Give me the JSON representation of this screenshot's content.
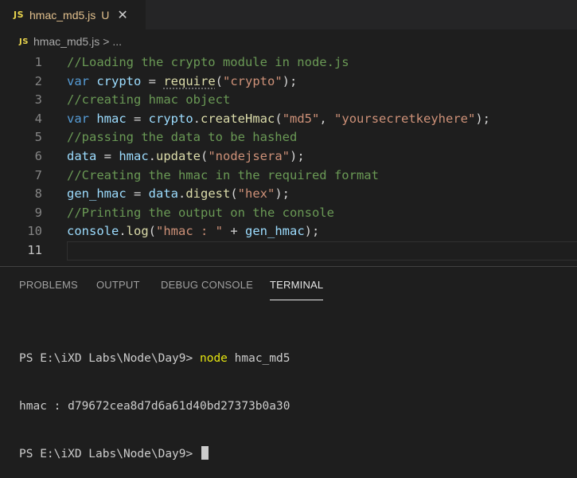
{
  "tab": {
    "badge": "JS",
    "title": "hmac_md5.js",
    "status": "U",
    "close_glyph": "✕"
  },
  "breadcrumb": {
    "badge": "JS",
    "file": "hmac_md5.js",
    "separator": ">",
    "more": "..."
  },
  "editor": {
    "lines": [
      {
        "num": "1",
        "tokens": [
          [
            "comment",
            "//Loading the crypto module in node.js"
          ]
        ]
      },
      {
        "num": "2",
        "tokens": [
          [
            "kw",
            "var"
          ],
          [
            "op",
            " "
          ],
          [
            "var",
            "crypto"
          ],
          [
            "op",
            " = "
          ],
          [
            "fn",
            "require"
          ],
          [
            "op",
            "("
          ],
          [
            "str",
            "\"crypto\""
          ],
          [
            "op",
            ");"
          ]
        ]
      },
      {
        "num": "3",
        "tokens": [
          [
            "comment",
            "//creating hmac object"
          ]
        ]
      },
      {
        "num": "4",
        "tokens": [
          [
            "kw",
            "var"
          ],
          [
            "op",
            " "
          ],
          [
            "var",
            "hmac"
          ],
          [
            "op",
            " = "
          ],
          [
            "var",
            "crypto"
          ],
          [
            "op",
            "."
          ],
          [
            "fn",
            "createHmac"
          ],
          [
            "op",
            "("
          ],
          [
            "str",
            "\"md5\""
          ],
          [
            "op",
            ", "
          ],
          [
            "str",
            "\"yoursecretkeyhere\""
          ],
          [
            "op",
            ");"
          ]
        ]
      },
      {
        "num": "5",
        "tokens": [
          [
            "comment",
            "//passing the data to be hashed"
          ]
        ]
      },
      {
        "num": "6",
        "tokens": [
          [
            "var",
            "data"
          ],
          [
            "op",
            " = "
          ],
          [
            "var",
            "hmac"
          ],
          [
            "op",
            "."
          ],
          [
            "fn",
            "update"
          ],
          [
            "op",
            "("
          ],
          [
            "str",
            "\"nodejsera\""
          ],
          [
            "op",
            ");"
          ]
        ]
      },
      {
        "num": "7",
        "tokens": [
          [
            "comment",
            "//Creating the hmac in the required format"
          ]
        ]
      },
      {
        "num": "8",
        "tokens": [
          [
            "var",
            "gen_hmac"
          ],
          [
            "op",
            " = "
          ],
          [
            "var",
            "data"
          ],
          [
            "op",
            "."
          ],
          [
            "fn",
            "digest"
          ],
          [
            "op",
            "("
          ],
          [
            "str",
            "\"hex\""
          ],
          [
            "op",
            ");"
          ]
        ]
      },
      {
        "num": "9",
        "tokens": [
          [
            "comment",
            "//Printing the output on the console"
          ]
        ]
      },
      {
        "num": "10",
        "tokens": [
          [
            "var",
            "console"
          ],
          [
            "op",
            "."
          ],
          [
            "fn",
            "log"
          ],
          [
            "op",
            "("
          ],
          [
            "str",
            "\"hmac : \""
          ],
          [
            "op",
            " + "
          ],
          [
            "var",
            "gen_hmac"
          ],
          [
            "op",
            ");"
          ]
        ]
      },
      {
        "num": "11",
        "tokens": []
      }
    ]
  },
  "panel": {
    "tabs": [
      "PROBLEMS",
      "OUTPUT",
      "DEBUG CONSOLE",
      "TERMINAL"
    ],
    "active_tab": "TERMINAL"
  },
  "terminal": {
    "line1_prompt": "PS E:\\iXD Labs\\Node\\Day9> ",
    "line1_cmd": "node",
    "line1_args": " hmac_md5",
    "line2": "hmac : d79672cea8d7d6a61d40bd27373b0a30",
    "line3_prompt": "PS E:\\iXD Labs\\Node\\Day9> "
  },
  "colors": {
    "background": "#1e1e1e",
    "comment": "#6a9955",
    "keyword": "#569cd6",
    "variable": "#9cdcfe",
    "function": "#dcdcaa",
    "string": "#ce9178",
    "modified_file": "#e2c08d",
    "js_badge": "#e8d44d",
    "terminal_command": "#e5e510"
  }
}
